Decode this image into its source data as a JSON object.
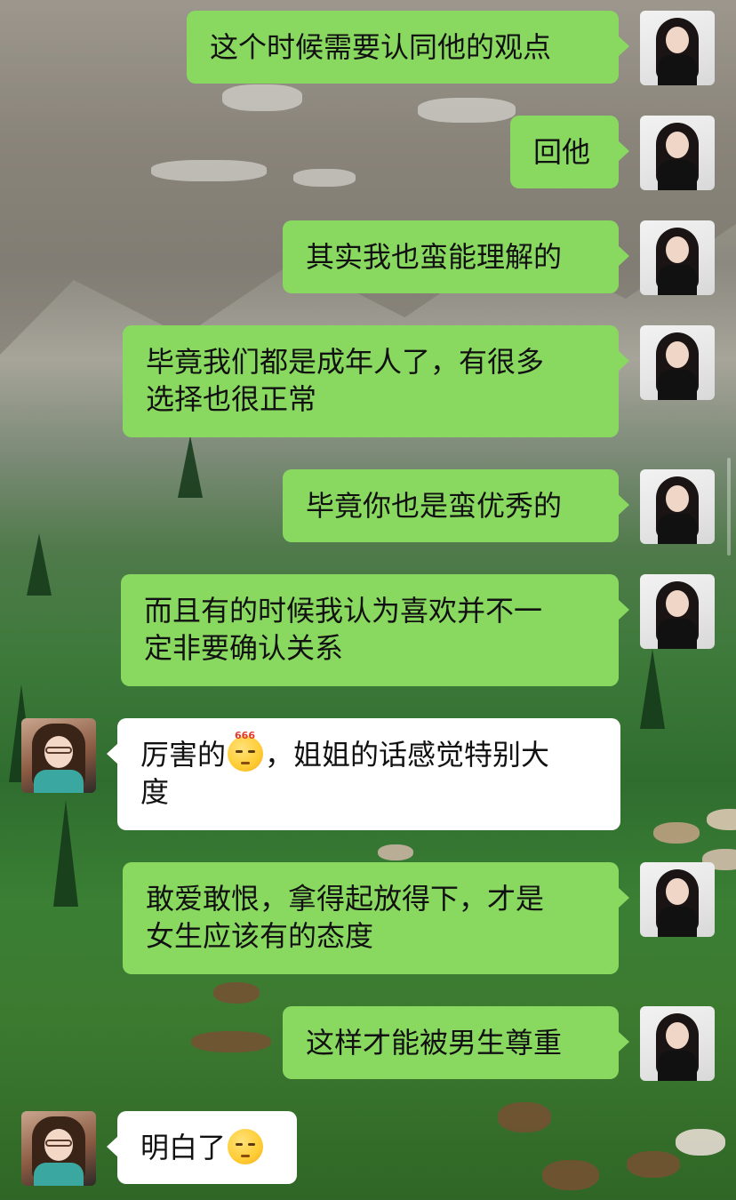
{
  "colors": {
    "self_bubble": "#89d961",
    "other_bubble": "#ffffff",
    "text": "#111111"
  },
  "messages": [
    {
      "from": "self",
      "text": "这个时候需要认同他的观点"
    },
    {
      "from": "self",
      "text": "回他"
    },
    {
      "from": "self",
      "text": "其实我也蛮能理解的"
    },
    {
      "from": "self",
      "text_line1": "毕竟我们都是成年人了，有很多",
      "text_line2": "选择也很正常"
    },
    {
      "from": "self",
      "text": "毕竟你也是蛮优秀的"
    },
    {
      "from": "self",
      "text_line1": "而且有的时候我认为喜欢并不一",
      "text_line2": "定非要确认关系"
    },
    {
      "from": "other",
      "text_before_emoji": "厉害的",
      "emoji": "666-smirk-emoji",
      "emoji_label": "666",
      "text_after_emoji": "，姐姐的话感觉特别大",
      "text_line2": "度"
    },
    {
      "from": "self",
      "text_line1": "敢爱敢恨，拿得起放得下，才是",
      "text_line2": "女生应该有的态度"
    },
    {
      "from": "self",
      "text": "这样才能被男生尊重"
    },
    {
      "from": "other",
      "text_before_emoji": "明白了",
      "emoji": "smirk-emoji"
    }
  ]
}
